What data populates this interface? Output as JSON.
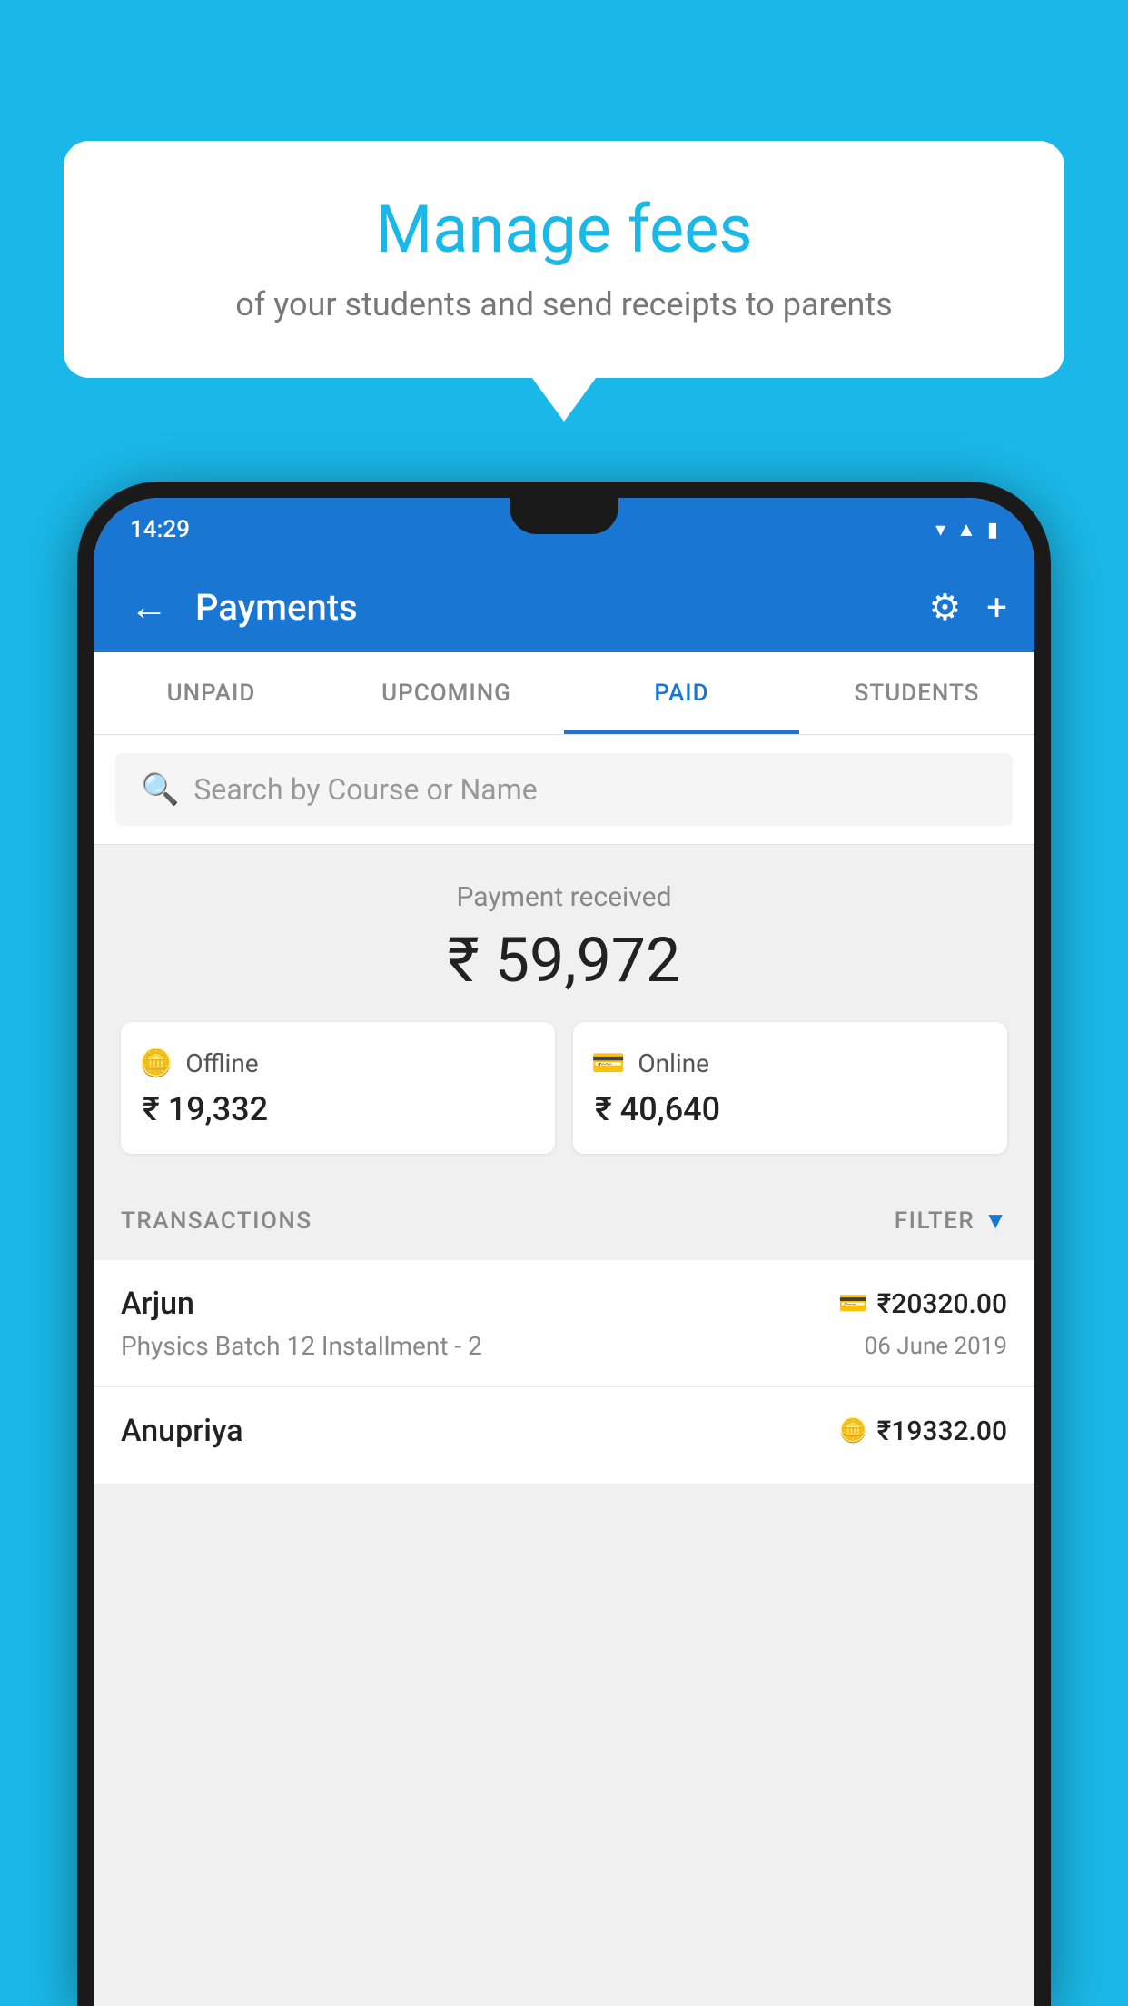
{
  "background": {
    "color": "#1ab8e8"
  },
  "speech_bubble": {
    "title": "Manage fees",
    "subtitle": "of your students and send receipts to parents"
  },
  "status_bar": {
    "time": "14:29"
  },
  "app_bar": {
    "title": "Payments",
    "back_label": "←",
    "gear_label": "⚙",
    "plus_label": "+"
  },
  "tabs": [
    {
      "label": "UNPAID",
      "active": false
    },
    {
      "label": "UPCOMING",
      "active": false
    },
    {
      "label": "PAID",
      "active": true
    },
    {
      "label": "STUDENTS",
      "active": false
    }
  ],
  "search": {
    "placeholder": "Search by Course or Name"
  },
  "payment_summary": {
    "label": "Payment received",
    "amount": "₹ 59,972",
    "offline": {
      "type": "Offline",
      "amount": "₹ 19,332"
    },
    "online": {
      "type": "Online",
      "amount": "₹ 40,640"
    }
  },
  "transactions": {
    "header": "TRANSACTIONS",
    "filter": "FILTER",
    "rows": [
      {
        "name": "Arjun",
        "course": "Physics Batch 12 Installment - 2",
        "amount": "₹20320.00",
        "date": "06 June 2019",
        "payment_type": "online"
      },
      {
        "name": "Anupriya",
        "course": "",
        "amount": "₹19332.00",
        "date": "",
        "payment_type": "offline"
      }
    ]
  }
}
